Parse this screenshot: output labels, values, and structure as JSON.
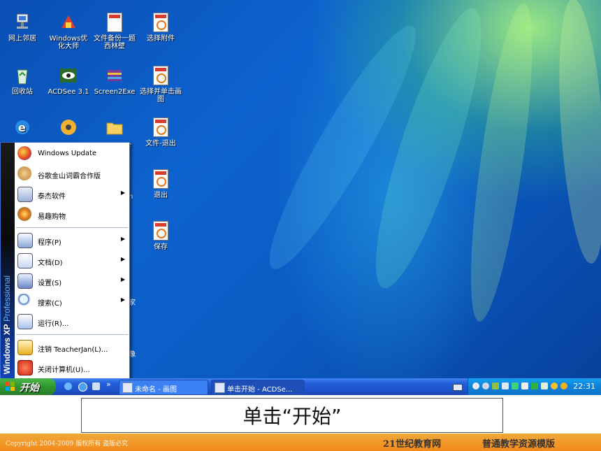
{
  "desktop": {
    "icons": [
      {
        "label": "网上邻居",
        "icon": "network-icon"
      },
      {
        "label": "Windows优化大师",
        "icon": "optimizer-icon"
      },
      {
        "label": "文件备份一题 西林壁",
        "icon": "ppt-file-icon"
      },
      {
        "label": "选择附件",
        "icon": "ppt-file-icon"
      },
      {
        "label": "回收站",
        "icon": "recycle-bin-icon"
      },
      {
        "label": "ACDSee 3.1",
        "icon": "acdsee-icon"
      },
      {
        "label": "Screen2Exe",
        "icon": "screen2exe-icon"
      },
      {
        "label": "选择并单击画图",
        "icon": "ppt-file-icon"
      },
      {
        "label": "文件-退出",
        "icon": "ppt-file-icon"
      },
      {
        "label": "退出",
        "icon": "ppt-file-icon"
      },
      {
        "label": "保存",
        "icon": "ppt-file-icon"
      }
    ],
    "partial_labels": [
      "e",
      "n",
      "家",
      "像"
    ]
  },
  "start_menu": {
    "sidebar_text_bold": "Windows XP",
    "sidebar_text_light": "Professional",
    "pinned": [
      {
        "label": "Windows Update",
        "icon": "windows-update-icon",
        "submenu": false
      },
      {
        "label": "谷歌金山词霸合作版",
        "icon": "dictionary-icon",
        "submenu": false
      },
      {
        "label": "泰杰软件",
        "icon": "program-group-icon",
        "submenu": true
      },
      {
        "label": "易趣购物",
        "icon": "shopping-icon",
        "submenu": false
      }
    ],
    "main": [
      {
        "label": "程序(P)",
        "icon": "programs-icon",
        "submenu": true
      },
      {
        "label": "文档(D)",
        "icon": "documents-icon",
        "submenu": true
      },
      {
        "label": "设置(S)",
        "icon": "settings-icon",
        "submenu": true
      },
      {
        "label": "搜索(C)",
        "icon": "search-icon",
        "submenu": true
      },
      {
        "label": "运行(R)...",
        "icon": "run-icon",
        "submenu": false
      }
    ],
    "bottom": [
      {
        "label": "注销 TeacherJan(L)...",
        "icon": "logoff-icon"
      },
      {
        "label": "关闭计算机(U)...",
        "icon": "shutdown-icon"
      }
    ]
  },
  "taskbar": {
    "start_label": "开始",
    "quicklaunch_more": "»",
    "buttons": [
      {
        "label": "未命名 - 画图",
        "icon": "paint-icon"
      },
      {
        "label": "单击开始 - ACDSe...",
        "icon": "acdsee-icon"
      }
    ],
    "clock": "22:31"
  },
  "caption": "单击“开始”",
  "footer": {
    "copyright": "Copyright 2004-2009 版权所有 盗版必究",
    "site": "21世纪教育网",
    "template": "普通教学资源模版"
  },
  "colors": {
    "taskbar": "#245edb",
    "start_button": "#2f962f",
    "tray": "#0f86dd",
    "footer": "#f28a1a"
  }
}
